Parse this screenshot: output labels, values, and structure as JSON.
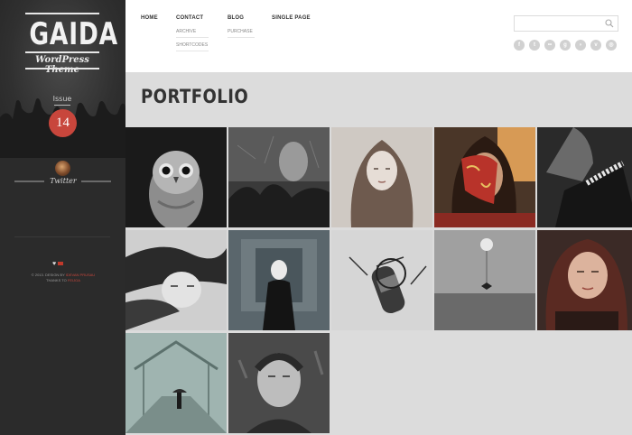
{
  "logo": {
    "title": "GAIDA",
    "subtitle": "WordPress Theme"
  },
  "issue": {
    "label": "Issue",
    "number": "14"
  },
  "twitter": {
    "label": "Twitter"
  },
  "footer": {
    "line1_prefix": "© 2013. DESIGN BY",
    "line1_author": "IDEVAN PRUSAU",
    "line2_prefix": "THANKS TO",
    "line2_author": "FEIJOA"
  },
  "nav": {
    "home": "HOME",
    "contact": "CONTACT",
    "contact_sub": [
      "ARCHIVE",
      "SHORTCODES"
    ],
    "blog": "BLOG",
    "blog_sub": [
      "PURCHASE"
    ],
    "single": "SINGLE PAGE"
  },
  "search": {
    "placeholder": "",
    "value": ""
  },
  "social": [
    "facebook-icon",
    "twitter-icon",
    "flickr-icon",
    "google-icon",
    "rss-icon",
    "vimeo-icon",
    "dribbble-icon"
  ],
  "page": {
    "title": "PORTFOLIO"
  },
  "portfolio": [
    "owl",
    "girl-in-storm",
    "woman-long-hair",
    "venetian-mask",
    "lace-collar",
    "woman-hair-blowing",
    "masked-figure",
    "microphone",
    "balloon-over-sea",
    "red-haired-woman",
    "umbrella-on-bridge",
    "woman-in-rain"
  ],
  "colors": {
    "accent": "#c8463c",
    "sidebar": "#2b2b2b",
    "background": "#dcdcdc"
  }
}
